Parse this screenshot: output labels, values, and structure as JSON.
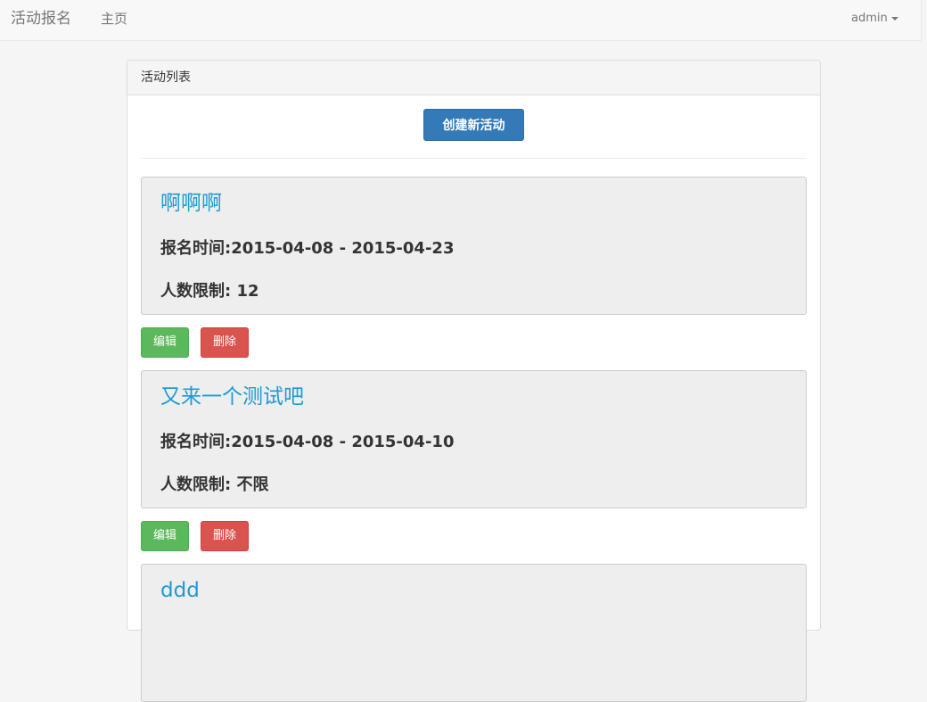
{
  "navbar": {
    "brand": "活动报名",
    "home_label": "主页",
    "user_label": "admin"
  },
  "panel": {
    "heading": "活动列表",
    "create_button_label": "创建新活动"
  },
  "events": [
    {
      "title": "啊啊啊",
      "time_text": "报名时间:2015-04-08 - 2015-04-23",
      "limit_text": "人数限制: 12",
      "edit_label": "编辑",
      "delete_label": "删除"
    },
    {
      "title": "又来一个测试吧",
      "time_text": "报名时间:2015-04-08 - 2015-04-10",
      "limit_text": "人数限制: 不限",
      "edit_label": "编辑",
      "delete_label": "删除"
    },
    {
      "title": "ddd"
    }
  ],
  "colors": {
    "primary": "#337ab7",
    "success": "#5cb85c",
    "danger": "#d9534f",
    "title_link": "#1e9ad6"
  }
}
